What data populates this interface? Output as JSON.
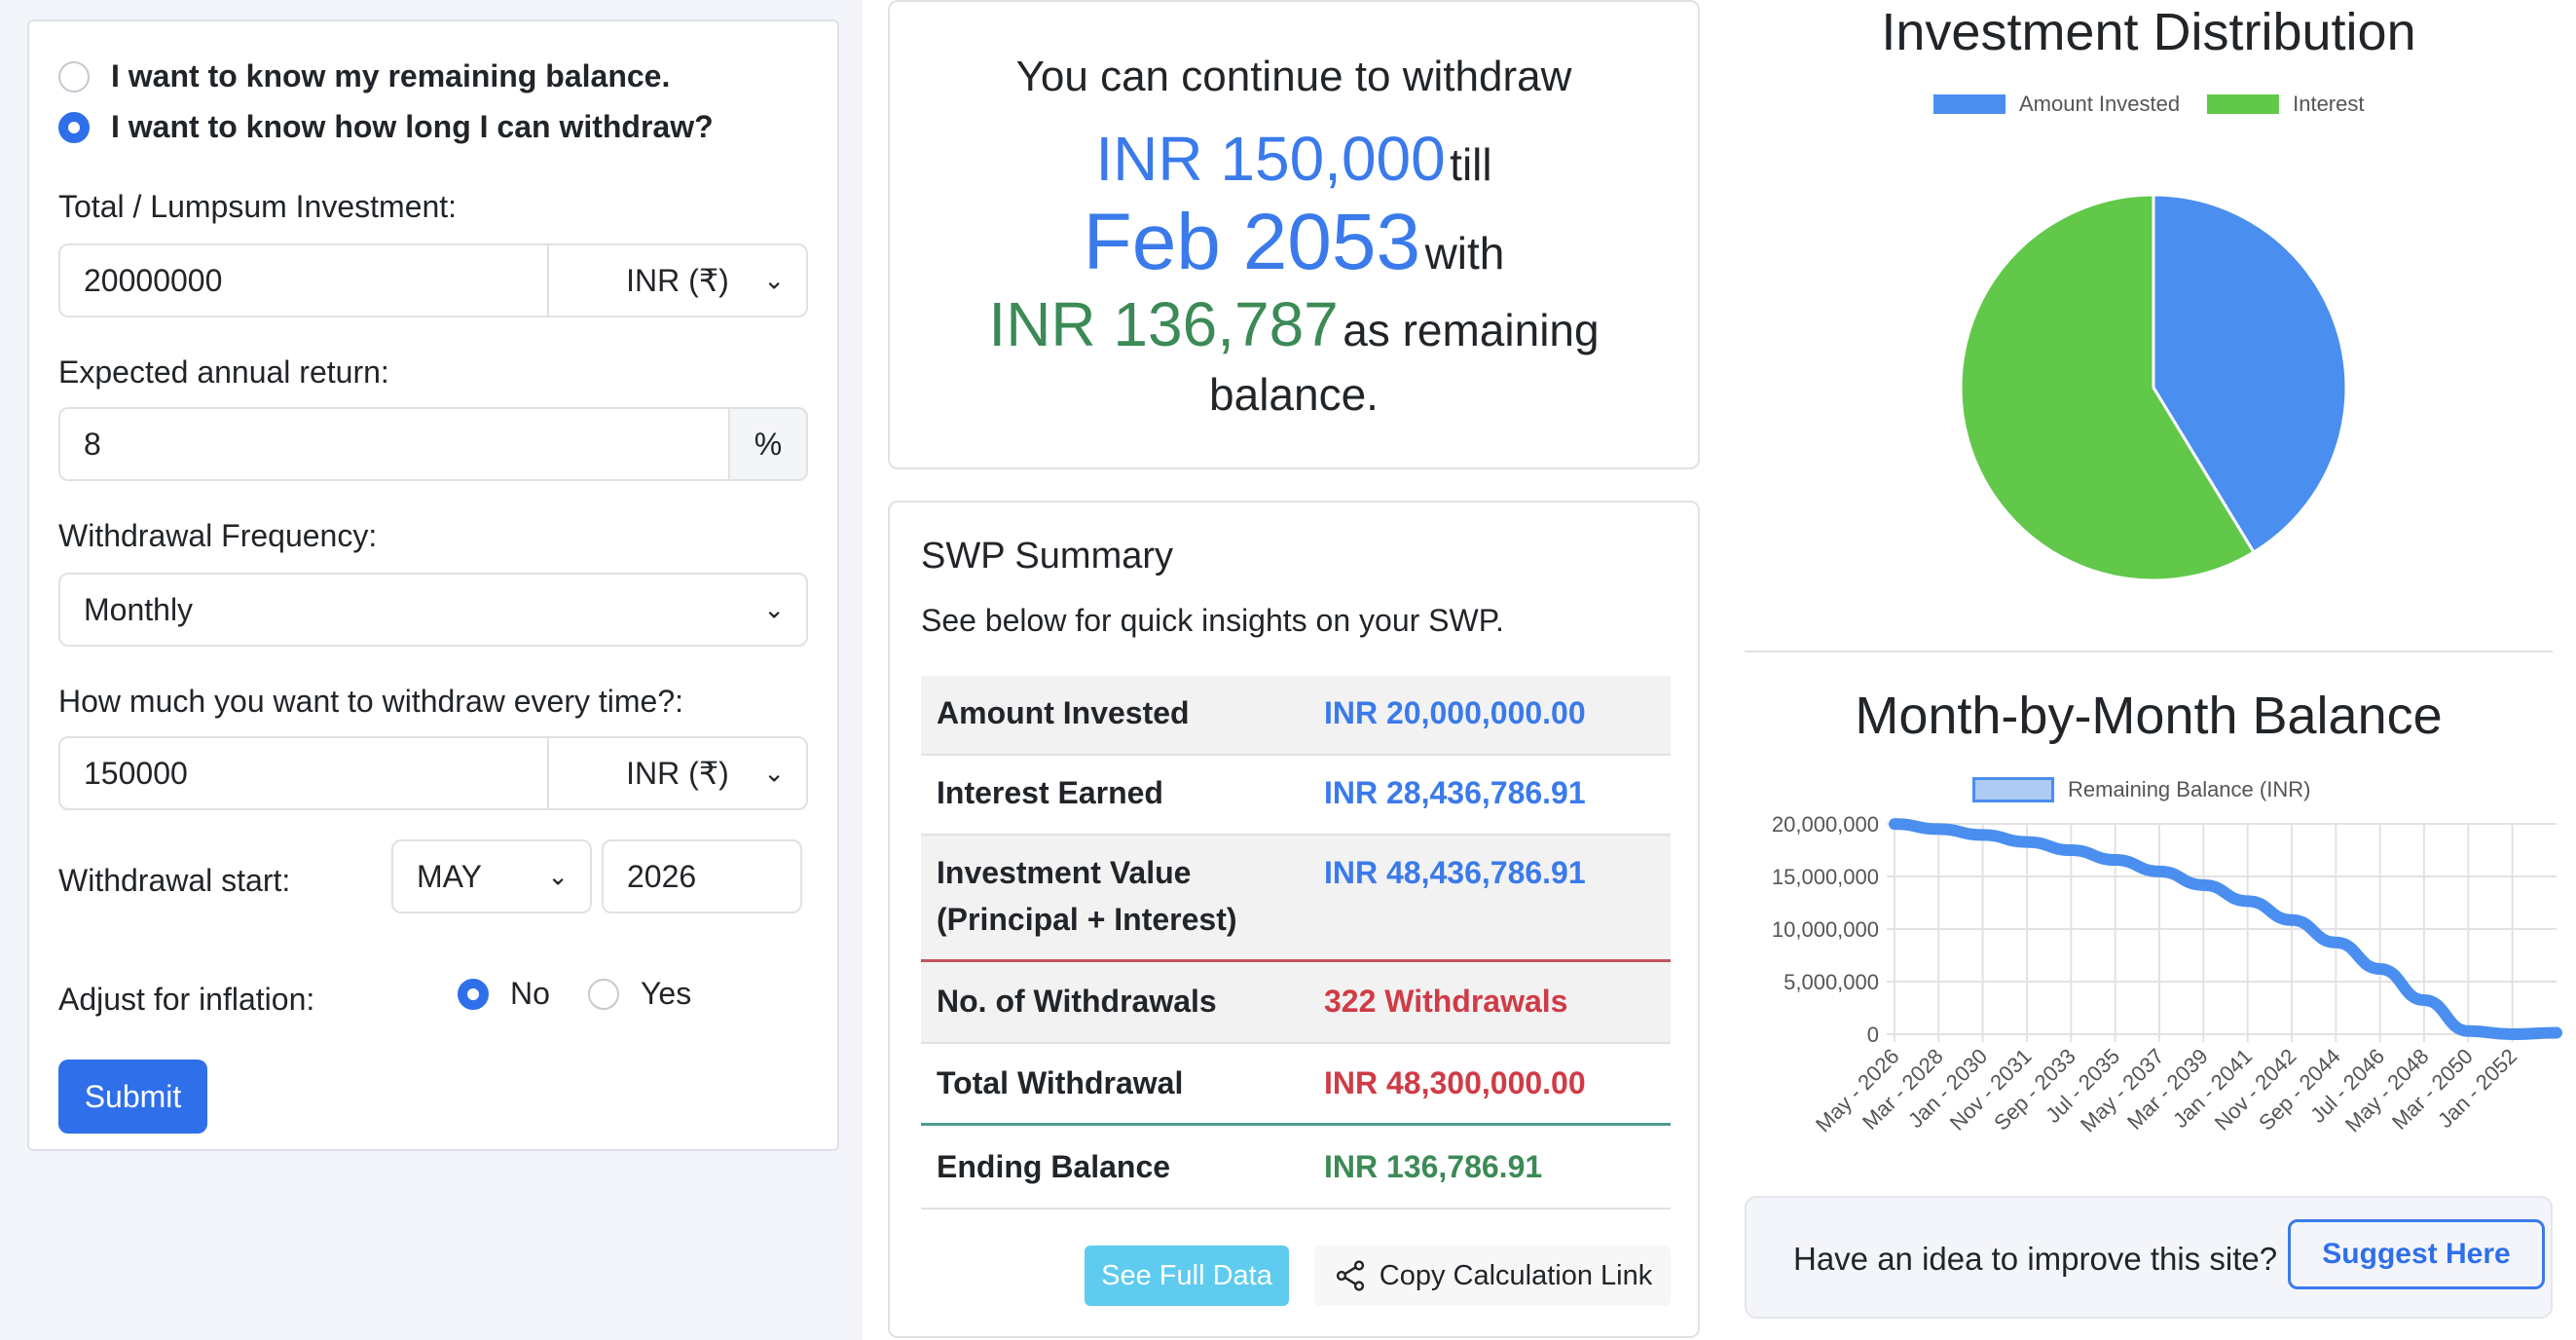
{
  "form": {
    "mode_options": [
      {
        "label": "I want to know my remaining balance.",
        "checked": false
      },
      {
        "label": "I want to know how long I can withdraw?",
        "checked": true
      }
    ],
    "investment_label": "Total / Lumpsum Investment:",
    "investment_value": "20000000",
    "investment_currency": "INR (₹)",
    "return_label": "Expected annual return:",
    "return_value": "8",
    "return_unit": "%",
    "frequency_label": "Withdrawal Frequency:",
    "frequency_value": "Monthly",
    "withdraw_label": "How much you want to withdraw every time?:",
    "withdraw_value": "150000",
    "withdraw_currency": "INR (₹)",
    "start_label": "Withdrawal start:",
    "start_month": "MAY",
    "start_year": "2026",
    "inflation_label": "Adjust for inflation:",
    "inflation_options": [
      {
        "label": "No",
        "checked": true
      },
      {
        "label": "Yes",
        "checked": false
      }
    ],
    "submit_label": "Submit"
  },
  "result": {
    "line1": "You can continue to withdraw",
    "amount": "INR 150,000",
    "till": "till",
    "date": "Feb 2053",
    "with": "with",
    "remaining": "INR 136,787",
    "remaining_suffix": "as remaining",
    "balance_word": "balance."
  },
  "summary": {
    "title": "SWP Summary",
    "subtitle": "See below for quick insights on your SWP.",
    "rows": [
      {
        "key": "Amount Invested",
        "value": "INR 20,000,000.00"
      },
      {
        "key": "Interest Earned",
        "value": "INR 28,436,786.91"
      },
      {
        "key": "Investment Value",
        "key2": "(Principal + Interest)",
        "value": "INR 48,436,786.91"
      },
      {
        "key": "No. of Withdrawals",
        "value": "322 Withdrawals"
      },
      {
        "key": "Total Withdrawal",
        "value": "INR 48,300,000.00"
      },
      {
        "key": "Ending Balance",
        "value": "INR 136,786.91"
      }
    ],
    "see_full_label": "See Full Data",
    "copy_link_label": "Copy Calculation Link"
  },
  "pie_chart": {
    "title": "Investment Distribution",
    "legend": [
      "Amount Invested",
      "Interest"
    ],
    "colors": {
      "invested": "#4a8ef0",
      "interest": "#62c84a"
    }
  },
  "line_chart": {
    "title": "Month-by-Month Balance",
    "legend": "Remaining Balance (INR)",
    "y_ticks": [
      "20,000,000",
      "15,000,000",
      "10,000,000",
      "5,000,000",
      "0"
    ],
    "x_ticks": [
      "May - 2026",
      "Mar - 2028",
      "Jan - 2030",
      "Nov - 2031",
      "Sep - 2033",
      "Jul - 2035",
      "May - 2037",
      "Mar - 2039",
      "Jan - 2041",
      "Nov - 2042",
      "Sep - 2044",
      "Jul - 2046",
      "May - 2048",
      "Mar - 2050",
      "Jan - 2052"
    ]
  },
  "chart_data": [
    {
      "type": "pie",
      "title": "Investment Distribution",
      "categories": [
        "Amount Invested",
        "Interest"
      ],
      "values": [
        20000000.0,
        28436786.91
      ],
      "colors": [
        "#4a8ef0",
        "#62c84a"
      ],
      "legend": "top"
    },
    {
      "type": "line",
      "title": "Month-by-Month Balance",
      "series": [
        {
          "name": "Remaining Balance (INR)",
          "x": [
            "May - 2026",
            "Mar - 2028",
            "Jan - 2030",
            "Nov - 2031",
            "Sep - 2033",
            "Jul - 2035",
            "May - 2037",
            "Mar - 2039",
            "Jan - 2041",
            "Nov - 2042",
            "Sep - 2044",
            "Jul - 2046",
            "May - 2048",
            "Mar - 2050",
            "Jan - 2052",
            "Feb - 2053"
          ],
          "values": [
            19983000,
            19507000,
            18945000,
            18281000,
            17497000,
            16570000,
            15476000,
            14183000,
            12656000,
            10853000,
            8723000,
            6207000,
            3236000,
            300000,
            0,
            136787
          ]
        }
      ],
      "ylim": [
        0,
        20000000
      ],
      "grid": true,
      "legend": "top"
    }
  ],
  "colors": {
    "primary": "#2f6fea",
    "blue_text": "#3a7aeb",
    "green_text": "#3c8a56",
    "red_text": "#d03b46",
    "info": "#5ecbef"
  }
}
